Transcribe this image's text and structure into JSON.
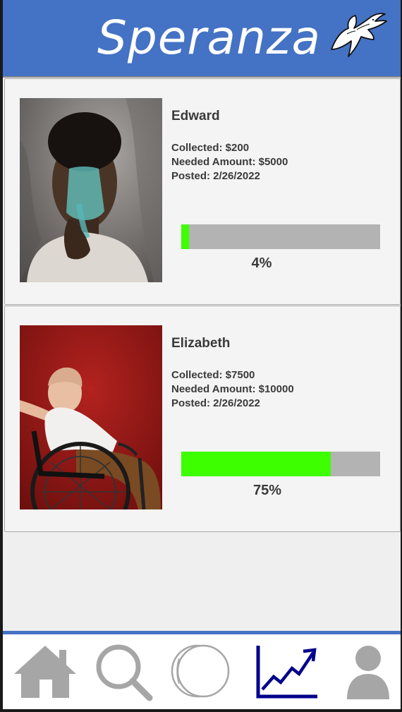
{
  "header": {
    "title": "Speranza",
    "logo_icon": "dove-icon"
  },
  "campaigns": [
    {
      "name": "Edward",
      "collected": "Collected: $200",
      "needed": "Needed Amount: $5000",
      "posted": "Posted: 2/26/2022",
      "progress_fraction": 0.04,
      "progress_label": "4%"
    },
    {
      "name": "Elizabeth",
      "collected": "Collected: $7500",
      "needed": "Needed Amount: $10000",
      "posted": "Posted: 2/26/2022",
      "progress_fraction": 0.75,
      "progress_label": "75%"
    }
  ],
  "nav": {
    "items": [
      {
        "icon": "home-icon",
        "active": false
      },
      {
        "icon": "search-icon",
        "active": false
      },
      {
        "icon": "coin-icon",
        "active": false
      },
      {
        "icon": "chart-trend-icon",
        "active": true
      },
      {
        "icon": "user-icon",
        "active": false
      }
    ]
  },
  "colors": {
    "header": "#4472c4",
    "progress_fill": "#3dff00",
    "progress_track": "#b3b3b3",
    "nav_active": "#00008b",
    "nav_inactive": "#a6a6a6"
  }
}
